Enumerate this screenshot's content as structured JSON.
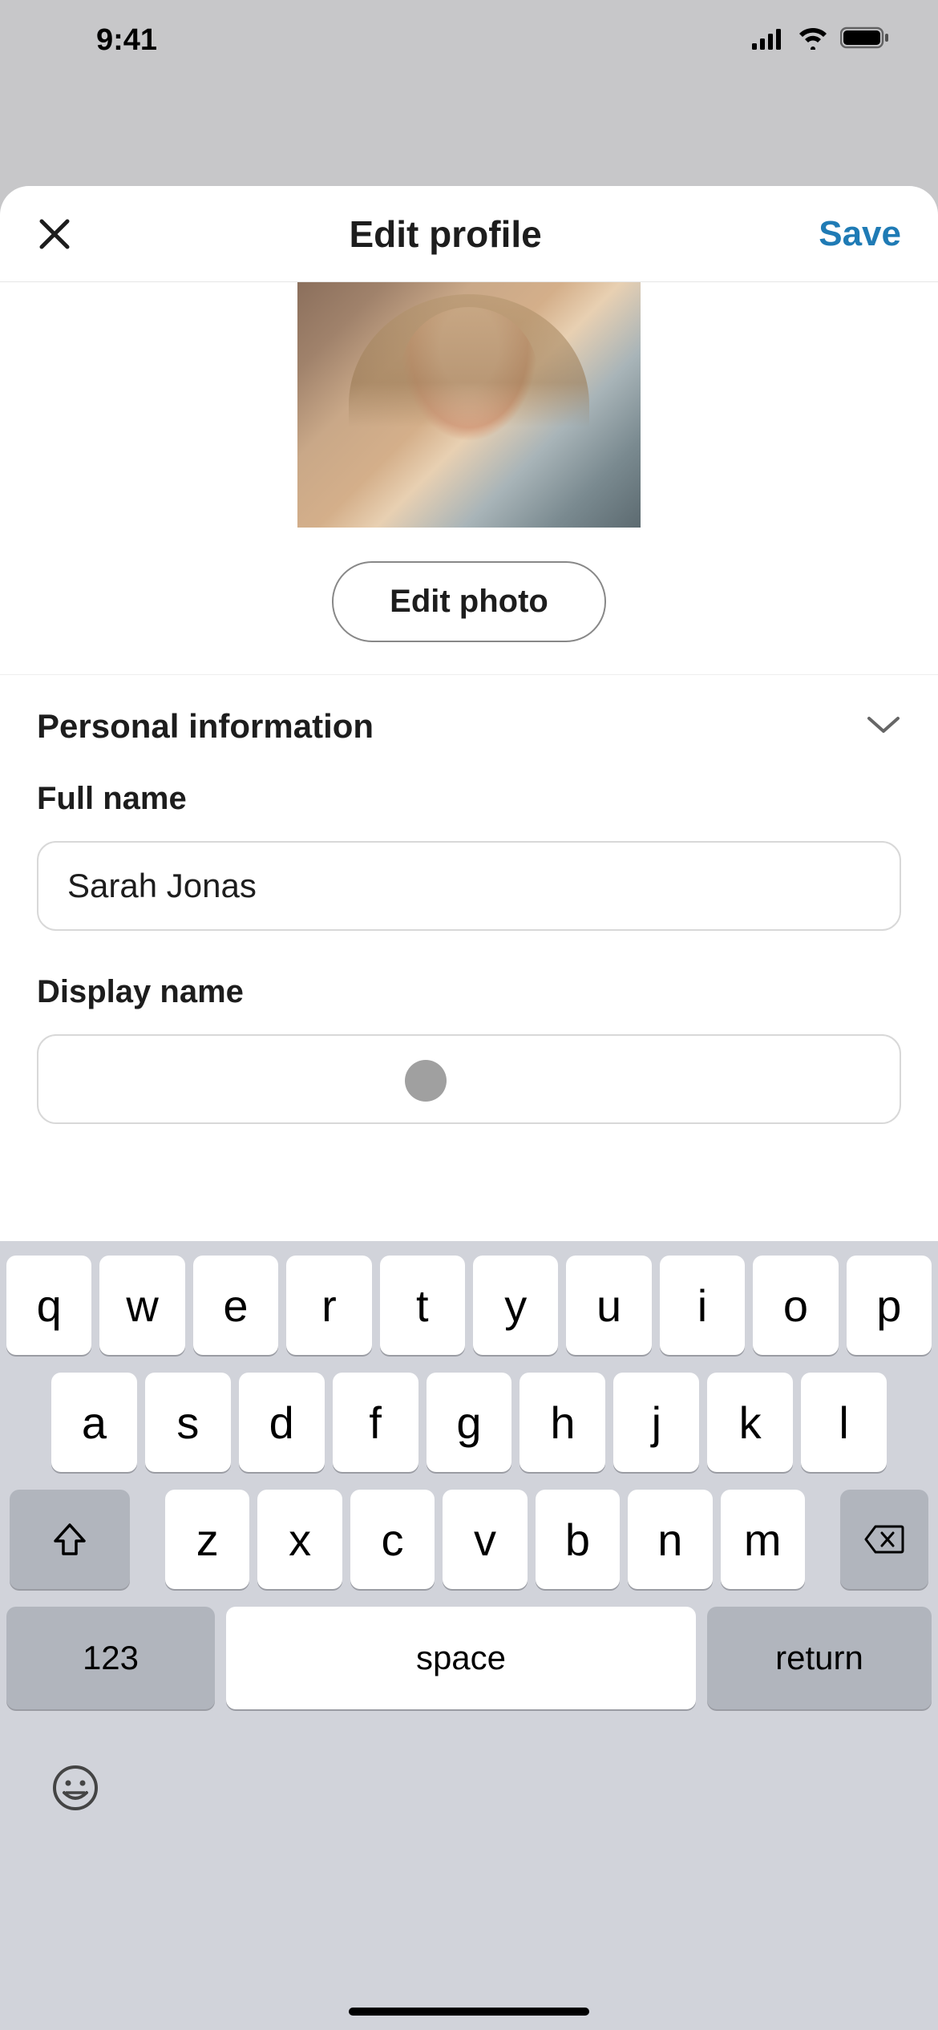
{
  "status": {
    "time": "9:41"
  },
  "header": {
    "title": "Edit profile",
    "save_label": "Save"
  },
  "photo": {
    "edit_button_label": "Edit photo"
  },
  "section": {
    "title": "Personal information"
  },
  "fields": {
    "full_name": {
      "label": "Full name",
      "value": "Sarah Jonas"
    },
    "display_name": {
      "label": "Display name",
      "value": ""
    }
  },
  "keyboard": {
    "row1": [
      "q",
      "w",
      "e",
      "r",
      "t",
      "y",
      "u",
      "i",
      "o",
      "p"
    ],
    "row2": [
      "a",
      "s",
      "d",
      "f",
      "g",
      "h",
      "j",
      "k",
      "l"
    ],
    "row3": [
      "z",
      "x",
      "c",
      "v",
      "b",
      "n",
      "m"
    ],
    "num_label": "123",
    "space_label": "space",
    "return_label": "return"
  }
}
